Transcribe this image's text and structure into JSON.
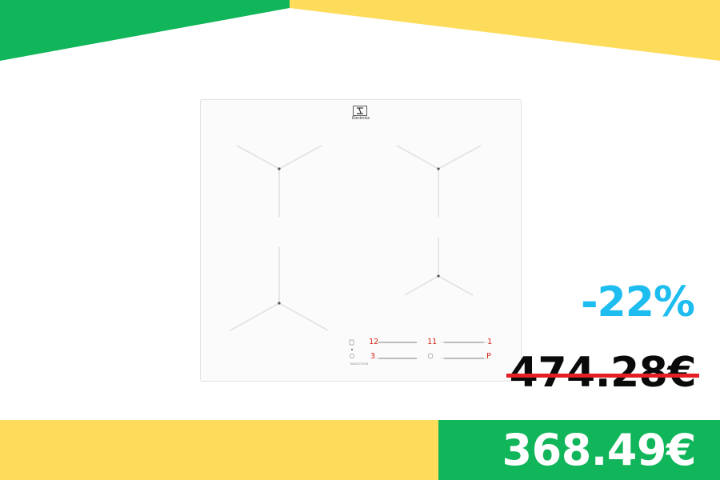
{
  "product": {
    "brand": "Electrolux",
    "label": "INDUCTION",
    "display": {
      "top_left": "12",
      "top_middle": "11",
      "top_right": "1",
      "bottom_left": "3",
      "bottom_right": "P"
    }
  },
  "pricing": {
    "discount": "-22%",
    "old_price": "474.28€",
    "new_price": "368.49€"
  },
  "colors": {
    "green": "#11b55a",
    "yellow": "#fddc5c",
    "discount_blue": "#1ebdf0",
    "strike_red": "#e31e24"
  }
}
